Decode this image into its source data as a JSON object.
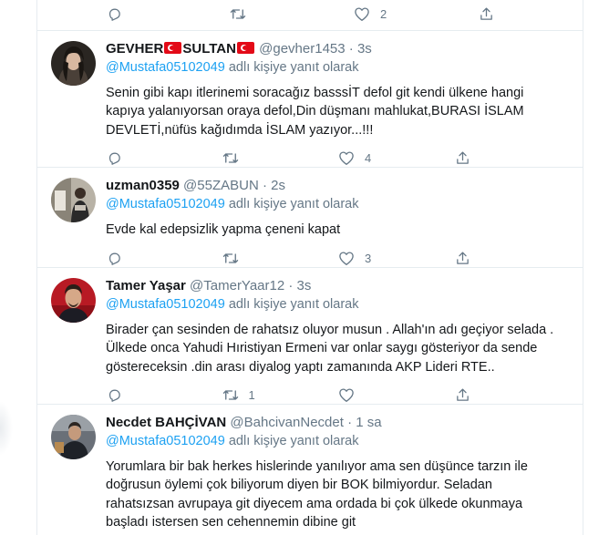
{
  "top_actions": {
    "reply_count": "",
    "retweet_count": "",
    "like_count": "2"
  },
  "colors": {
    "accent": "#1da1f2",
    "secondary_text": "#657786",
    "divider": "#e6ecf0",
    "flag_red": "#e30a17"
  },
  "tweets": [
    {
      "name_part1": "GEVHER",
      "name_part2": "SULTAN",
      "handle": "@gevher1453",
      "sep": "·",
      "time": "3s",
      "reply_mention": "@Mustafa05102049",
      "reply_suffix": " adlı kişiye yanıt olarak",
      "lines": [
        "Senin gibi kapı itlerinemi soracağız basssİT defol git kendi ülkene hangi",
        "kapıya yalanıyorsan oraya defol,Din düşmanı mahlukat,BURASI İSLAM",
        "DEVLETİ,nüfüs kağıdımda İSLAM yazıyor...!!!"
      ],
      "reply_count": "",
      "retweet_count": "",
      "like_count": "4"
    },
    {
      "name": "uzman0359",
      "handle": "@55ZABUN",
      "sep": "·",
      "time": "2s",
      "reply_mention": "@Mustafa05102049",
      "reply_suffix": " adlı kişiye yanıt olarak",
      "lines": [
        "Evde kal edepsizlik yapma çeneni kapat"
      ],
      "reply_count": "",
      "retweet_count": "",
      "like_count": "3"
    },
    {
      "name": "Tamer Yaşar",
      "handle": "@TamerYaar12",
      "sep": "·",
      "time": "3s",
      "reply_mention": "@Mustafa05102049",
      "reply_suffix": " adlı kişiye yanıt olarak",
      "lines": [
        "Birader çan sesinden de rahatsız oluyor musun . Allah'ın adı geçiyor selada .",
        "Ülkede onca Yahudi Hıristiyan Ermeni var onlar saygı gösteriyor da sende",
        "göstereceksin  .din arası diyalog yaptı zamanında AKP Lideri RTE.."
      ],
      "reply_count": "",
      "retweet_count": "1",
      "like_count": ""
    },
    {
      "name": "Necdet BAHÇİVAN",
      "handle": "@BahcivanNecdet",
      "sep": "·",
      "time": "1 sa",
      "reply_mention": "@Mustafa05102049",
      "reply_suffix": " adlı kişiye yanıt olarak",
      "lines": [
        "Yorumlara bir bak herkes hislerinde  yanılıyor ama sen düşünce tarzın ile",
        "doğrusun öylemi çok biliyorum diyen bir BOK bilmiyordur. Seladan",
        "rahatsızsan avrupaya git diyecem ama ordada bi çok ülkede okunmaya",
        "başladı istersen sen cehennemin dibine git"
      ]
    }
  ]
}
